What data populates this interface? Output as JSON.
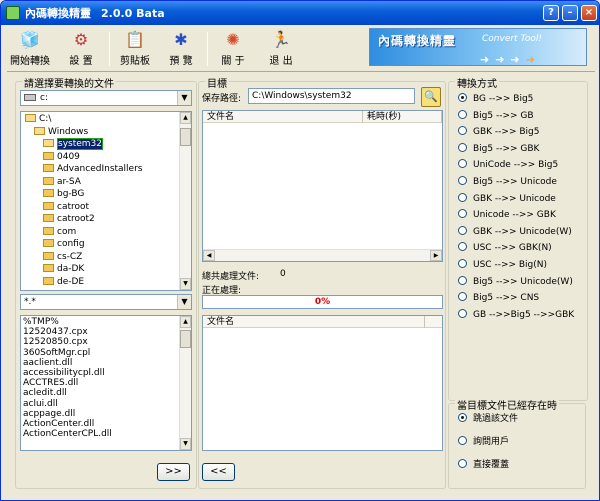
{
  "window": {
    "title": "內碼轉換精靈",
    "version": "2.0.0 Bata",
    "controls": [
      "?",
      "–",
      "×"
    ]
  },
  "toolbar": [
    {
      "label": "開始轉換",
      "icon": "start-convert-icon",
      "glyph": "🧊"
    },
    {
      "label": "設 置",
      "icon": "settings-icon",
      "glyph": "⚙"
    },
    {
      "label": "剪貼板",
      "icon": "clipboard-icon",
      "glyph": "📋"
    },
    {
      "label": "預 覽",
      "icon": "preview-icon",
      "glyph": "✱"
    },
    {
      "label": "關 于",
      "icon": "about-icon",
      "glyph": "✺"
    },
    {
      "label": "退 出",
      "icon": "exit-icon",
      "glyph": "🏃"
    }
  ],
  "banner": {
    "title": "內碼轉換精靈",
    "subtitle": "Convert Tool!"
  },
  "source": {
    "group_label": "請選擇要轉換的文件",
    "drive": "c:",
    "tree": [
      {
        "label": "C:\\",
        "level": 0,
        "open": true,
        "selected": false
      },
      {
        "label": "Windows",
        "level": 1,
        "open": true,
        "selected": false
      },
      {
        "label": "system32",
        "level": 2,
        "open": true,
        "selected": true
      },
      {
        "label": "0409",
        "level": 2,
        "open": false,
        "selected": false
      },
      {
        "label": "AdvancedInstallers",
        "level": 2,
        "open": false,
        "selected": false
      },
      {
        "label": "ar-SA",
        "level": 2,
        "open": false,
        "selected": false
      },
      {
        "label": "bg-BG",
        "level": 2,
        "open": false,
        "selected": false
      },
      {
        "label": "catroot",
        "level": 2,
        "open": false,
        "selected": false
      },
      {
        "label": "catroot2",
        "level": 2,
        "open": false,
        "selected": false
      },
      {
        "label": "com",
        "level": 2,
        "open": false,
        "selected": false
      },
      {
        "label": "config",
        "level": 2,
        "open": false,
        "selected": false
      },
      {
        "label": "cs-CZ",
        "level": 2,
        "open": false,
        "selected": false
      },
      {
        "label": "da-DK",
        "level": 2,
        "open": false,
        "selected": false
      },
      {
        "label": "de-DE",
        "level": 2,
        "open": false,
        "selected": false
      }
    ],
    "filter": "*.*",
    "files": [
      "%TMP%",
      "12520437.cpx",
      "12520850.cpx",
      "360SoftMgr.cpl",
      "aaclient.dll",
      "accessibilitycpl.dll",
      "ACCTRES.dll",
      "acledit.dll",
      "aclui.dll",
      "acppage.dll",
      "ActionCenter.dll",
      "ActionCenterCPL.dll"
    ],
    "add_button": ">>"
  },
  "target": {
    "group_label": "目標",
    "save_path_label": "保存路徑:",
    "save_path": "C:\\Windows\\system32",
    "columns": [
      "文件名",
      "耗時(秒)"
    ],
    "total_label": "總共處理文件:",
    "total_value": "0",
    "processing_label": "正在處理:",
    "progress": "0%",
    "queue_column": "文件名",
    "remove_button": "<<"
  },
  "mode": {
    "group_label": "轉換方式",
    "selected_index": 0,
    "options": [
      "BG -->> Big5",
      "Big5 -->> GB",
      "GBK -->> Big5",
      "Big5 -->> GBK",
      "UniCode -->> Big5",
      "Big5 -->> Unicode",
      "GBK -->> Unicode",
      "Unicode -->> GBK",
      "GBK -->> Unicode(W)",
      "USC -->> GBK(N)",
      "USC -->> Big(N)",
      "Big5 -->> Unicode(W)",
      "Big5 -->> CNS",
      "GB -->>Big5 -->>GBK"
    ]
  },
  "exists": {
    "group_label": "當目標文件已經存在時",
    "selected_index": 0,
    "options": [
      "跳過該文件",
      "詢問用戶",
      "直接覆蓋"
    ]
  }
}
